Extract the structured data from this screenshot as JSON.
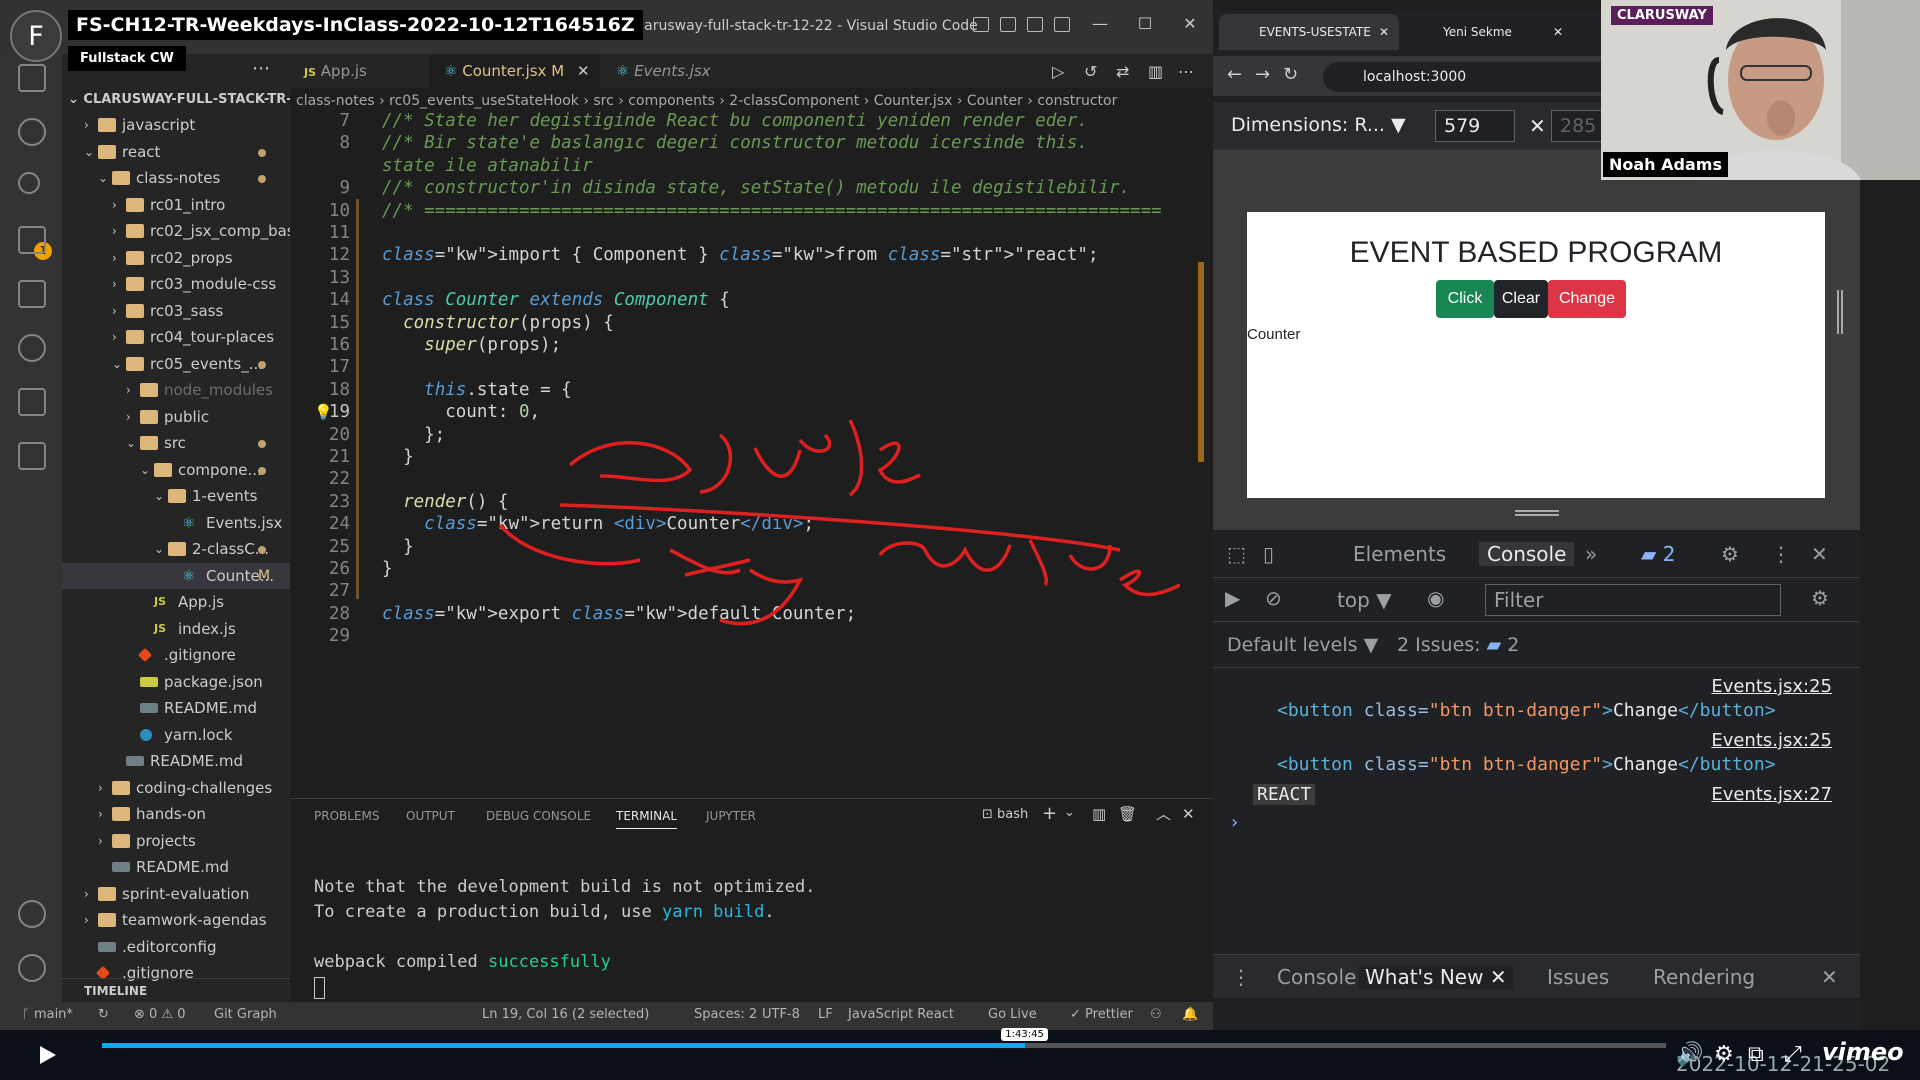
{
  "video": {
    "title": "FS-CH12-TR-Weekdays-InClass-2022-10-12T164516Z",
    "channel": "Fullstack CW",
    "avatar_letter": "F"
  },
  "vscode": {
    "window_title": "Counter.jsx - clarusway-full-stack-tr-12-22 - Visual Studio Code",
    "explorer_root": "CLARUSWAY-FULL-STACK-TR-...",
    "scm_badge": "1",
    "tree": [
      {
        "label": "javascript",
        "type": "folder",
        "depth": 1,
        "open": false
      },
      {
        "label": "react",
        "type": "folder",
        "depth": 1,
        "open": true,
        "mod": "dot"
      },
      {
        "label": "class-notes",
        "type": "folder",
        "depth": 2,
        "open": true,
        "mod": "dot"
      },
      {
        "label": "rc01_intro",
        "type": "folder",
        "depth": 3,
        "open": false
      },
      {
        "label": "rc02_jsx_comp_bas...",
        "type": "folder",
        "depth": 3,
        "open": false
      },
      {
        "label": "rc02_props",
        "type": "folder",
        "depth": 3,
        "open": false
      },
      {
        "label": "rc03_module-css",
        "type": "folder",
        "depth": 3,
        "open": false
      },
      {
        "label": "rc03_sass",
        "type": "folder",
        "depth": 3,
        "open": false
      },
      {
        "label": "rc04_tour-places",
        "type": "folder",
        "depth": 3,
        "open": false
      },
      {
        "label": "rc05_events_...",
        "type": "folder",
        "depth": 3,
        "open": true,
        "mod": "dot"
      },
      {
        "label": "node_modules",
        "type": "folder",
        "depth": 4,
        "open": false,
        "dim": true
      },
      {
        "label": "public",
        "type": "folder",
        "depth": 4,
        "open": false
      },
      {
        "label": "src",
        "type": "folder",
        "depth": 4,
        "open": true,
        "mod": "dot"
      },
      {
        "label": "compone...",
        "type": "folder",
        "depth": 5,
        "open": true,
        "mod": "dot"
      },
      {
        "label": "1-events",
        "type": "folder",
        "depth": 6,
        "open": true
      },
      {
        "label": "Events.jsx",
        "type": "react",
        "depth": 7
      },
      {
        "label": "2-classC...",
        "type": "folder",
        "depth": 6,
        "open": true,
        "mod": "dot"
      },
      {
        "label": "Counte...",
        "type": "react",
        "depth": 7,
        "mod": "M",
        "selected": true
      },
      {
        "label": "App.js",
        "type": "js",
        "depth": 5
      },
      {
        "label": "index.js",
        "type": "js",
        "depth": 5
      },
      {
        "label": ".gitignore",
        "type": "git",
        "depth": 4
      },
      {
        "label": "package.json",
        "type": "json",
        "depth": 4
      },
      {
        "label": "README.md",
        "type": "md",
        "depth": 4
      },
      {
        "label": "yarn.lock",
        "type": "yarn",
        "depth": 4
      },
      {
        "label": "README.md",
        "type": "md",
        "depth": 3
      },
      {
        "label": "coding-challenges",
        "type": "folder",
        "depth": 2,
        "open": false
      },
      {
        "label": "hands-on",
        "type": "folder",
        "depth": 2,
        "open": false
      },
      {
        "label": "projects",
        "type": "folder",
        "depth": 2,
        "open": false
      },
      {
        "label": "README.md",
        "type": "md",
        "depth": 2
      },
      {
        "label": "sprint-evaluation",
        "type": "folder",
        "depth": 1,
        "open": false
      },
      {
        "label": "teamwork-agendas",
        "type": "folder",
        "depth": 1,
        "open": false
      },
      {
        "label": ".editorconfig",
        "type": "md",
        "depth": 1
      },
      {
        "label": ".gitignore",
        "type": "git",
        "depth": 1
      }
    ],
    "timeline_label": "TIMELINE",
    "tabs": [
      {
        "label": "App.js",
        "icon": "JS",
        "active": false
      },
      {
        "label": "Counter.jsx",
        "suffix": "M",
        "icon": "react",
        "active": true
      },
      {
        "label": "Events.jsx",
        "icon": "react",
        "active": false
      }
    ],
    "breadcrumb": "class-notes › rc05_events_useStateHook › src › components › 2-classComponent › Counter.jsx › Counter › constructor",
    "code_lines": [
      {
        "n": "7",
        "text": "//* State her degistiginde React bu componenti yeniden render eder."
      },
      {
        "n": "8",
        "text": "//* Bir state'e baslangıc degeri constructor metodu icersinde this."
      },
      {
        "n": "",
        "text": "state ile atanabilir"
      },
      {
        "n": "9",
        "text": "//* constructor'in disinda state, setState() metodu ile degistilebilir."
      },
      {
        "n": "10",
        "text": "//* ======================================================================"
      },
      {
        "n": "11",
        "text": ""
      },
      {
        "n": "12",
        "text": "import { Component } from \"react\";"
      },
      {
        "n": "13",
        "text": ""
      },
      {
        "n": "14",
        "text": "class Counter extends Component {"
      },
      {
        "n": "15",
        "text": "  constructor(props) {"
      },
      {
        "n": "16",
        "text": "    super(props);"
      },
      {
        "n": "17",
        "text": ""
      },
      {
        "n": "18",
        "text": "    this.state = {"
      },
      {
        "n": "19",
        "text": "      count: 0,"
      },
      {
        "n": "20",
        "text": "    };"
      },
      {
        "n": "21",
        "text": "  }"
      },
      {
        "n": "22",
        "text": ""
      },
      {
        "n": "23",
        "text": "  render() {"
      },
      {
        "n": "24",
        "text": "    return <div>Counter</div>;"
      },
      {
        "n": "25",
        "text": "  }"
      },
      {
        "n": "26",
        "text": "}"
      },
      {
        "n": "27",
        "text": ""
      },
      {
        "n": "28",
        "text": "export default Counter;"
      },
      {
        "n": "29",
        "text": ""
      }
    ],
    "annotations": {
      "obje": "obje",
      "key": "key",
      "value": "value"
    },
    "panel_tabs": [
      "PROBLEMS",
      "OUTPUT",
      "DEBUG CONSOLE",
      "TERMINAL",
      "JUPYTER"
    ],
    "panel_active": "TERMINAL",
    "shell": "bash",
    "terminal": {
      "line1": "Note that the development build is not optimized.",
      "line2_a": "To create a production build, use ",
      "line2_b": "yarn build",
      "line2_c": ".",
      "line3_a": "webpack compiled ",
      "line3_b": "successfully"
    },
    "status": {
      "branch": "main*",
      "problems": "⊗ 0 ⚠ 0",
      "git_graph": "Git Graph",
      "cursor": "Ln 19, Col 16 (2 selected)",
      "spaces": "Spaces: 2",
      "encoding": "UTF-8",
      "eol": "LF",
      "lang": "JavaScript React",
      "golive": "Go Live",
      "prettier": "✓ Prettier"
    }
  },
  "browser": {
    "tabs": [
      {
        "label": "EVENTS-USESTATE",
        "active": true
      },
      {
        "label": "Yeni Sekme",
        "active": false
      }
    ],
    "url": "localhost:3000",
    "dimensions_label": "Dimensions: R...",
    "width": "579",
    "height": "285",
    "page": {
      "title": "EVENT BASED PROGRAM",
      "buttons": [
        {
          "label": "Click",
          "color": "#198754"
        },
        {
          "label": "Clear",
          "color": "#212529"
        },
        {
          "label": "Change",
          "color": "#dc3545"
        }
      ],
      "counter": "Counter"
    },
    "devtools": {
      "tabs": [
        "Elements",
        "Console"
      ],
      "active_tab": "Console",
      "more": "»",
      "issues_badge": "2",
      "context": "top",
      "filter_placeholder": "Filter",
      "levels": "Default levels",
      "issues_label": "2 Issues:",
      "issues_count": "2",
      "logs": [
        {
          "src": "Events.jsx:25",
          "tag_open": "<button ",
          "attr": "class=",
          "val": "\"btn btn-danger\"",
          "close": ">",
          "text": "Change",
          "tag_close": "</button>"
        },
        {
          "src": "Events.jsx:25",
          "tag_open": "<button ",
          "attr": "class=",
          "val": "\"btn btn-danger\"",
          "close": ">",
          "text": "Change",
          "tag_close": "</button>"
        }
      ],
      "react_log": {
        "text": "REACT",
        "src": "Events.jsx:27"
      },
      "prompt": "›",
      "drawer_tabs": [
        "Console",
        "What's New",
        "Issues",
        "Rendering"
      ],
      "drawer_active": "What's New"
    }
  },
  "webcam": {
    "brand": "CLARUSWAY",
    "name": "Noah Adams"
  },
  "player": {
    "time_tip": "1:43:45",
    "progress": 0.59,
    "brand": "vimeo",
    "timestamp": "2022-10-12-21-25-02"
  }
}
